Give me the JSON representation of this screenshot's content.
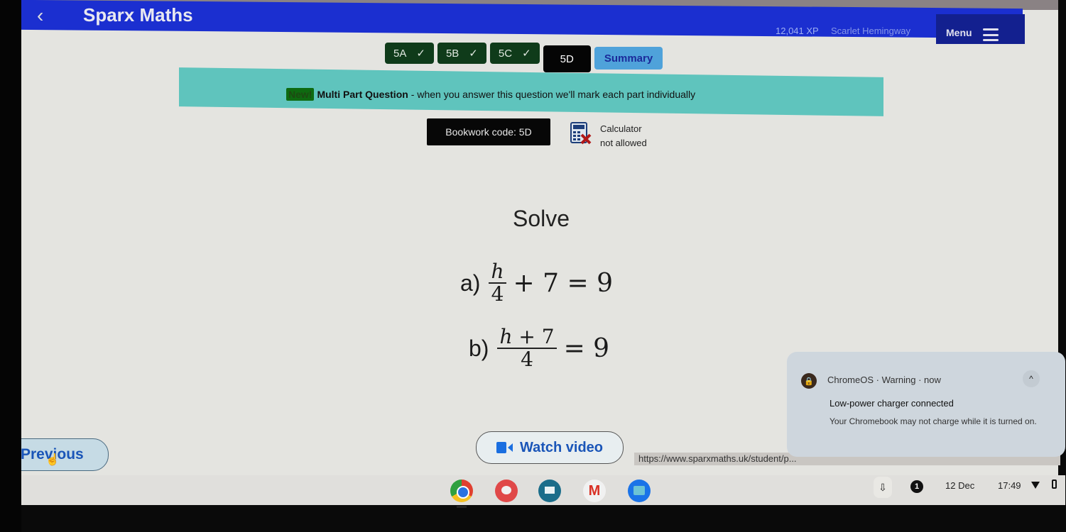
{
  "app": {
    "title": "Sparx Maths",
    "xp": "12,041 XP",
    "user_name": "Scarlet Hemingway",
    "menu_label": "Menu"
  },
  "tabs": [
    {
      "label": "5A",
      "completed": true
    },
    {
      "label": "5B",
      "completed": true
    },
    {
      "label": "5C",
      "completed": true
    },
    {
      "label": "5D",
      "completed": false,
      "active": true
    },
    {
      "label": "Summary",
      "completed": false
    }
  ],
  "check_glyph": "✓",
  "banner": {
    "badge": "New!",
    "title": "Multi Part Question",
    "text": " - when you answer this question we'll mark each part individually"
  },
  "bookwork": {
    "label": "Bookwork code: 5D"
  },
  "calculator": {
    "line1": "Calculator",
    "line2": "not allowed"
  },
  "question": {
    "instruction": "Solve",
    "parts": [
      {
        "label": "a)",
        "numerator": "h",
        "denominator": "4",
        "rest": "+ 7 = 9"
      },
      {
        "label": "b)",
        "numerator_var": "h",
        "numerator_rest": " + 7",
        "denominator": "4",
        "rest": "= 9"
      }
    ]
  },
  "nav": {
    "previous_label": "Previous",
    "previous_glyph": "‹",
    "watch_video_label": "Watch video"
  },
  "status_url": "https://www.sparxmaths.uk/student/p...",
  "notification": {
    "source": "ChromeOS · Warning · now",
    "title": "Low-power charger connected",
    "body": "Your Chromebook may not charge while it is turned on.",
    "collapse_glyph": "^"
  },
  "shelf": {
    "apps": [
      "Chrome",
      "Canvas",
      "Classroom",
      "Gmail",
      "Files"
    ],
    "gmail_glyph": "M",
    "notification_count": "1",
    "date": "12 Dec",
    "time": "17:49"
  },
  "colors": {
    "topbar": "#1b2fd0",
    "tab_done": "#0f3b1a",
    "tab_active": "#050505",
    "summary": "#4fa2da",
    "banner": "#5fc4bd",
    "link_blue": "#1a55b8"
  }
}
